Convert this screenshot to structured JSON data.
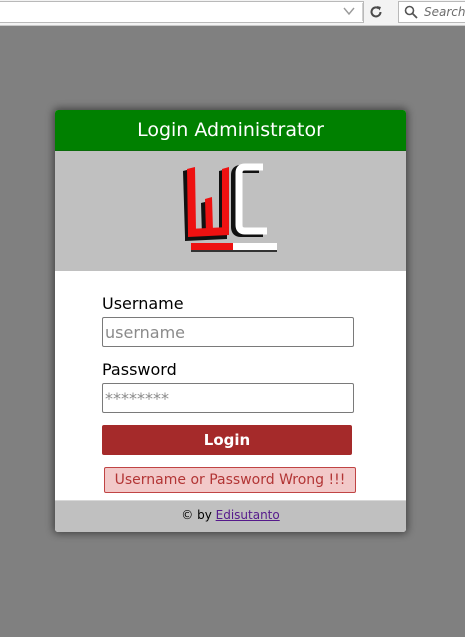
{
  "browser": {
    "search_placeholder": "Search",
    "icons": [
      "dropdown-icon",
      "reload-icon",
      "search-icon"
    ]
  },
  "card": {
    "title": "Login Administrator",
    "logo_icon": "wc-logo",
    "username": {
      "label": "Username",
      "placeholder": "username",
      "value": ""
    },
    "password": {
      "label": "Password",
      "placeholder": "********",
      "value": ""
    },
    "login_label": "Login",
    "error_message": "Username or Password Wrong !!!",
    "footer": {
      "prefix": "© by ",
      "author_link": "Edisutanto"
    }
  },
  "colors": {
    "header": "#008000",
    "button": "#a52a2a",
    "error_bg": "#f2c9c9",
    "error_text": "#b23535",
    "band": "#c0c0c0",
    "page_bg": "#808080"
  }
}
